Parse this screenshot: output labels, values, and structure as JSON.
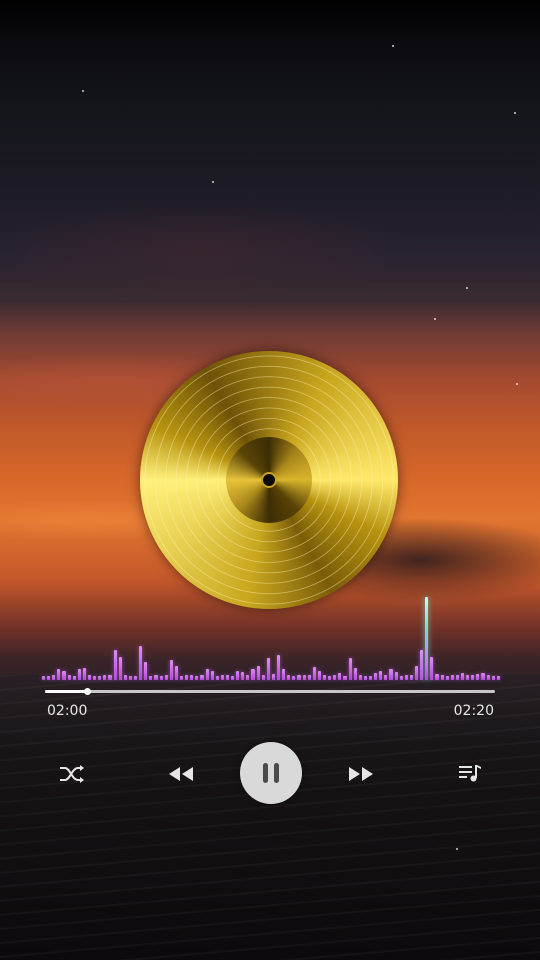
{
  "player": {
    "elapsed": "02:00",
    "duration": "02:20",
    "progress_fraction": 0.094,
    "state": "playing"
  },
  "visualizer": {
    "bar_levels": [
      0.04,
      0.04,
      0.05,
      0.12,
      0.1,
      0.05,
      0.04,
      0.12,
      0.13,
      0.05,
      0.04,
      0.04,
      0.06,
      0.05,
      0.33,
      0.25,
      0.05,
      0.04,
      0.04,
      0.38,
      0.2,
      0.04,
      0.05,
      0.04,
      0.06,
      0.22,
      0.15,
      0.04,
      0.05,
      0.05,
      0.04,
      0.05,
      0.12,
      0.1,
      0.04,
      0.05,
      0.06,
      0.04,
      0.1,
      0.09,
      0.05,
      0.12,
      0.16,
      0.05,
      0.24,
      0.07,
      0.28,
      0.12,
      0.05,
      0.04,
      0.05,
      0.05,
      0.06,
      0.14,
      0.1,
      0.05,
      0.04,
      0.05,
      0.08,
      0.04,
      0.24,
      0.13,
      0.05,
      0.04,
      0.04,
      0.08,
      0.1,
      0.05,
      0.12,
      0.09,
      0.04,
      0.05,
      0.05,
      0.15,
      0.33,
      0.92,
      0.26,
      0.07,
      0.05,
      0.04,
      0.05,
      0.06,
      0.08,
      0.05,
      0.06,
      0.07,
      0.08,
      0.06,
      0.04,
      0.04
    ],
    "peak_index": 75,
    "bar_color": "#c565e8",
    "peak_color": "#8ff0e0"
  },
  "controls": {
    "shuffle_icon": "shuffle-icon",
    "previous_icon": "rewind-icon",
    "play_pause_icon": "pause-icon",
    "next_icon": "fast-forward-icon",
    "playlist_icon": "playlist-icon"
  },
  "theme": {
    "record_color": "#d4b020",
    "button_bg": "#d9d9d9",
    "text_color": "#e8e8e8"
  }
}
